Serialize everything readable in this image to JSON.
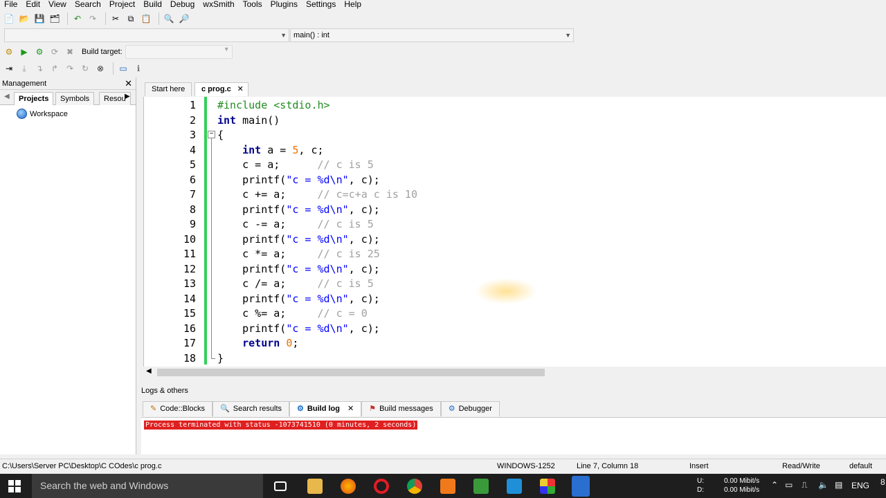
{
  "menu": [
    "File",
    "Edit",
    "View",
    "Search",
    "Project",
    "Build",
    "Debug",
    "wxSmith",
    "Tools",
    "Plugins",
    "Settings",
    "Help"
  ],
  "toolbar": {
    "scope_combo": "",
    "function_combo": "main() : int",
    "build_target_label": "Build target:",
    "build_target_value": ""
  },
  "management": {
    "title": "Management",
    "tabs": [
      "Projects",
      "Symbols",
      "Resou"
    ],
    "workspace": "Workspace"
  },
  "editor_tabs": [
    "Start here",
    "c prog.c"
  ],
  "code_lines": [
    {
      "n": "1",
      "html": "<span class=\"pp\">#include &lt;stdio.h&gt;</span>"
    },
    {
      "n": "2",
      "html": "<span class=\"kw\">int</span> main()"
    },
    {
      "n": "3",
      "html": "{"
    },
    {
      "n": "4",
      "html": "    <span class=\"kw\">int</span> a = <span class=\"num\">5</span>, c;"
    },
    {
      "n": "5",
      "html": "    c = a;      <span class=\"cm\">// c is 5</span>"
    },
    {
      "n": "6",
      "html": "    printf(<span class=\"str\">\"c = %d\\n\"</span>, c);"
    },
    {
      "n": "7",
      "html": "    c += a;     <span class=\"cm\">// c=c+a c is 10</span>"
    },
    {
      "n": "8",
      "html": "    printf(<span class=\"str\">\"c = %d\\n\"</span>, c);"
    },
    {
      "n": "9",
      "html": "    c -= a;     <span class=\"cm\">// c is 5</span>"
    },
    {
      "n": "10",
      "html": "    printf(<span class=\"str\">\"c = %d\\n\"</span>, c);"
    },
    {
      "n": "11",
      "html": "    c *= a;     <span class=\"cm\">// c is 25</span>"
    },
    {
      "n": "12",
      "html": "    printf(<span class=\"str\">\"c = %d\\n\"</span>, c);"
    },
    {
      "n": "13",
      "html": "    c /= a;     <span class=\"cm\">// c is 5</span>"
    },
    {
      "n": "14",
      "html": "    printf(<span class=\"str\">\"c = %d\\n\"</span>, c);"
    },
    {
      "n": "15",
      "html": "    c %= a;     <span class=\"cm\">// c = 0</span>"
    },
    {
      "n": "16",
      "html": "    printf(<span class=\"str\">\"c = %d\\n\"</span>, c);"
    },
    {
      "n": "17",
      "html": "    <span class=\"kw\">return</span> <span class=\"num\">0</span>;"
    },
    {
      "n": "18",
      "html": "}"
    }
  ],
  "logs": {
    "title": "Logs & others",
    "tabs": [
      "Code::Blocks",
      "Search results",
      "Build log",
      "Build messages",
      "Debugger"
    ],
    "line": "Process terminated with status -1073741510 (0 minutes, 2 seconds)"
  },
  "status": {
    "path": "C:\\Users\\Server PC\\Desktop\\C COdes\\c prog.c",
    "encoding": "WINDOWS-1252",
    "position": "Line 7, Column 18",
    "mode": "Insert",
    "access": "Read/Write",
    "lang": "default"
  },
  "taskbar": {
    "search_placeholder": "Search the web and Windows",
    "net_up_label": "U:",
    "net_down_label": "D:",
    "net_up": "0.00 Mibit/s",
    "net_down": "0.00 Mibit/s",
    "language": "ENG",
    "clock_partial": "8"
  }
}
